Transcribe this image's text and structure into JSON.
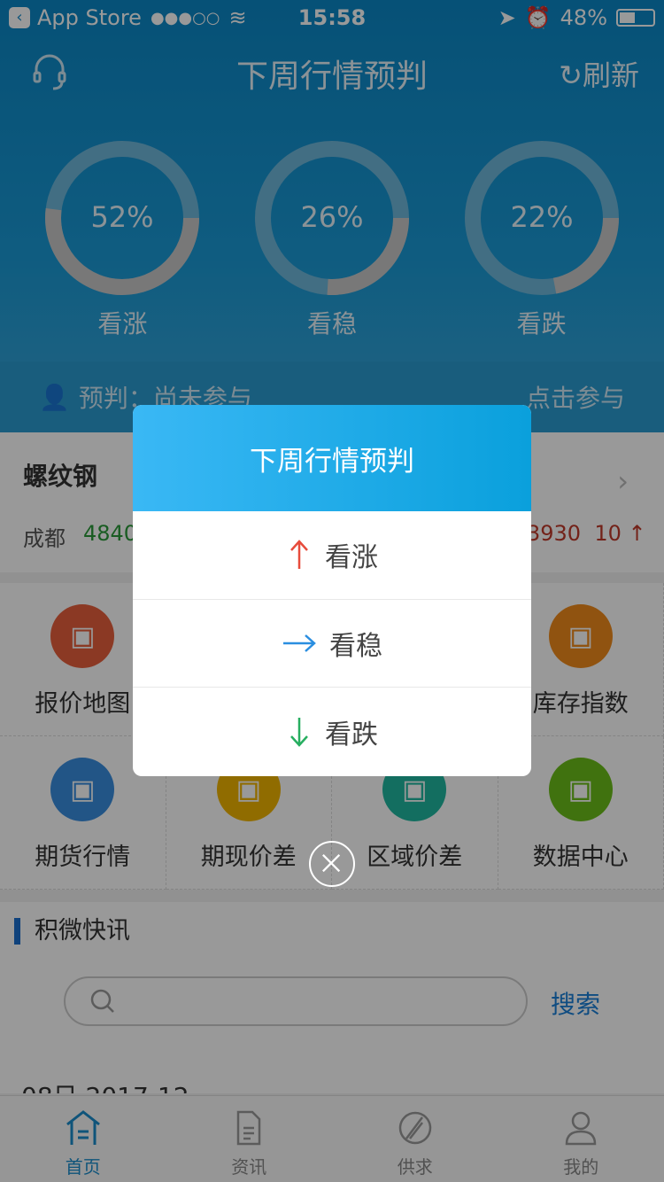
{
  "status_bar": {
    "back_app": "App Store",
    "signal": "●●●○○",
    "time": "15:58",
    "battery": "48%",
    "battery_level": 0.48
  },
  "header": {
    "title": "下周行情预判",
    "refresh": "刷新"
  },
  "rings": [
    {
      "percent": "52%",
      "value": 52,
      "label": "看涨"
    },
    {
      "percent": "26%",
      "value": 26,
      "label": "看稳"
    },
    {
      "percent": "22%",
      "value": 22,
      "label": "看跌"
    }
  ],
  "participation": {
    "label": "预判：尚未参与",
    "action": "点击参与"
  },
  "price_card": {
    "name": "螺纹钢",
    "city": "成都",
    "price": "4840",
    "price2": "3930",
    "change": "10 ↑"
  },
  "grid": [
    {
      "label": "报价地图",
      "color": "#e8603c",
      "icon": "map-pin-icon"
    },
    {
      "label": "",
      "color": "#ffffff",
      "icon": ""
    },
    {
      "label": "",
      "color": "#ffffff",
      "icon": ""
    },
    {
      "label": "库存指数",
      "color": "#f08a1c",
      "icon": "warehouse-icon"
    },
    {
      "label": "期货行情",
      "color": "#3a8ee0",
      "icon": "bar-chart-icon"
    },
    {
      "label": "期现价差",
      "color": "#f0b400",
      "icon": "yen-calendar-icon"
    },
    {
      "label": "区域价差",
      "color": "#20b8a0",
      "icon": "region-map-icon"
    },
    {
      "label": "数据中心",
      "color": "#6cbf1a",
      "icon": "monitor-chart-icon"
    }
  ],
  "news": {
    "title": "积微快讯",
    "search_placeholder": "",
    "search_button": "搜索",
    "date": "08日 2017-12"
  },
  "tabs": [
    {
      "label": "首页",
      "active": true
    },
    {
      "label": "资讯"
    },
    {
      "label": "供求"
    },
    {
      "label": "我的"
    }
  ],
  "dialog": {
    "title": "下周行情预判",
    "options": [
      {
        "label": "看涨",
        "color": "#e74c3c"
      },
      {
        "label": "看稳",
        "color": "#2a8ee0"
      },
      {
        "label": "看跌",
        "color": "#27ae60"
      }
    ]
  }
}
